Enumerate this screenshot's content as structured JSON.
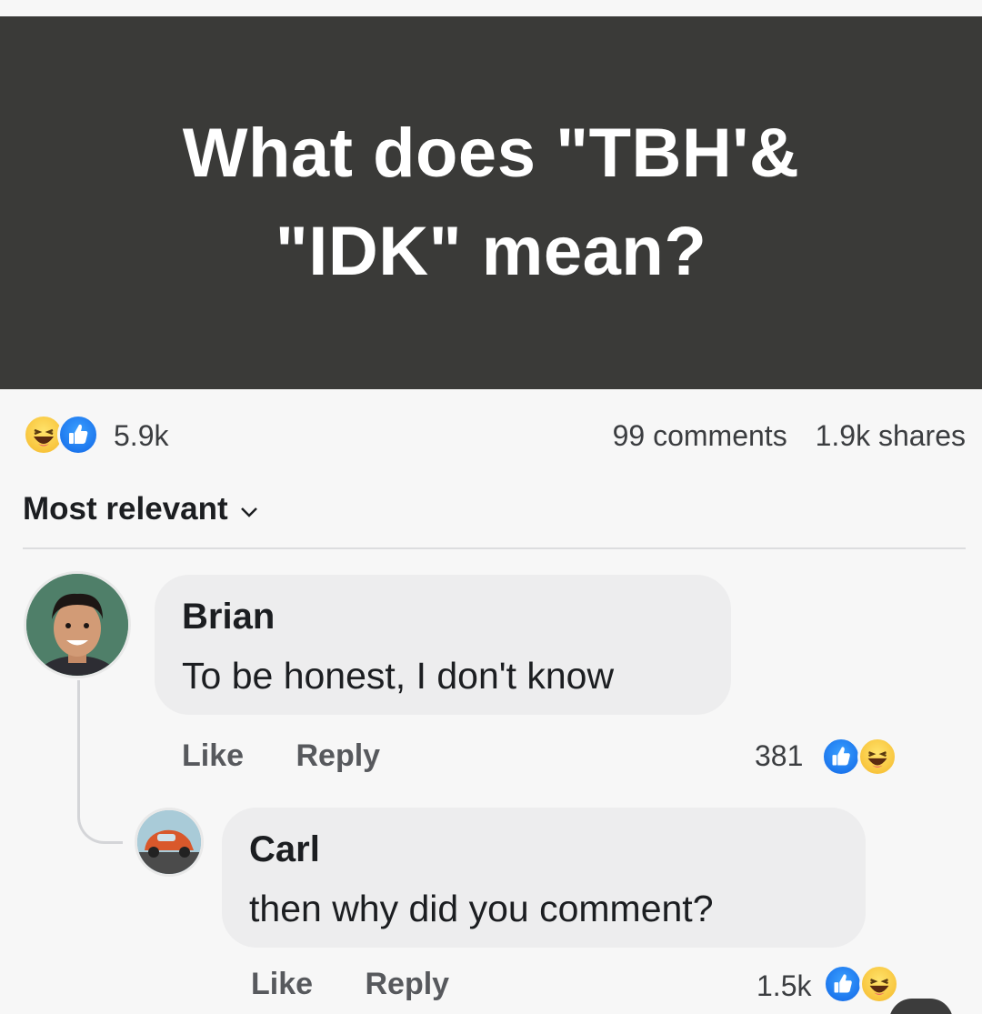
{
  "post": {
    "banner_text": "What does \"TBH'& \"IDK\" mean?"
  },
  "summary": {
    "reaction_count": "5.9k",
    "comments": "99 comments",
    "shares": "1.9k shares",
    "reactions": [
      "haha-emoji-icon",
      "like-emoji-icon"
    ]
  },
  "sort": {
    "label": "Most relevant"
  },
  "comments": [
    {
      "author": "Brian",
      "text": "To be honest, I don't know",
      "like_label": "Like",
      "reply_label": "Reply",
      "reaction_count": "381"
    },
    {
      "author": "Carl",
      "text": "then why did you comment?",
      "like_label": "Like",
      "reply_label": "Reply",
      "reaction_count": "1.5k"
    }
  ],
  "colors": {
    "banner_bg": "#3a3a38",
    "like_blue": "#1877f2",
    "haha_yellow": "#f7c23b"
  }
}
